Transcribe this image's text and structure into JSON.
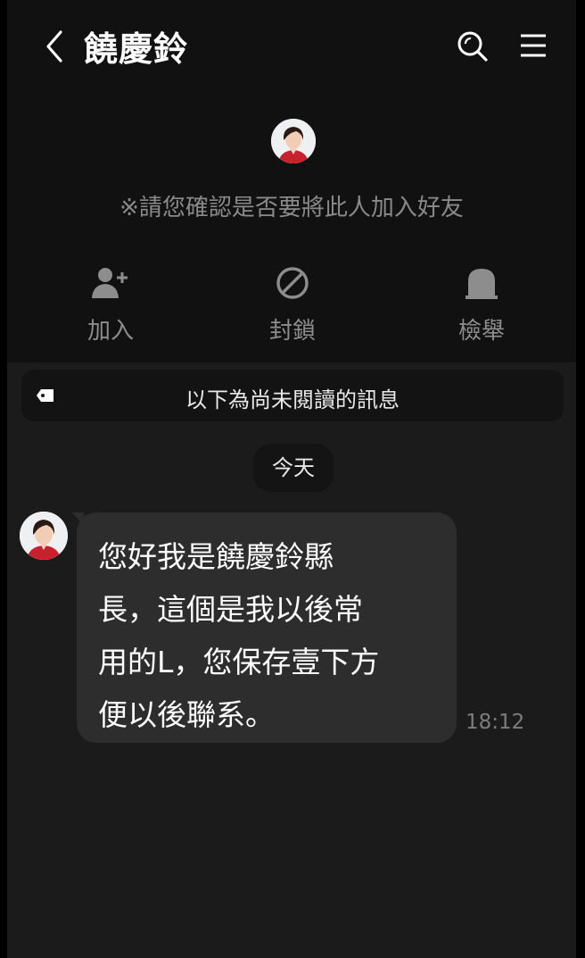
{
  "header": {
    "title": "饒慶鈴"
  },
  "profile": {
    "confirm_text": "※請您確認是否要將此人加入好友"
  },
  "actions": [
    {
      "label": "加入",
      "icon": "add-friend-icon"
    },
    {
      "label": "封鎖",
      "icon": "block-icon"
    },
    {
      "label": "檢舉",
      "icon": "report-icon"
    }
  ],
  "chat": {
    "unread_label": "以下為尚未閱讀的訊息",
    "date_label": "今天",
    "messages": [
      {
        "text": "您好我是饒慶鈴縣\n長，這個是我以後常\n用的L，您保存壹下方\n便以後聯系。",
        "time": "18:12"
      }
    ]
  },
  "colors": {
    "background": "#1b1b1b",
    "header_background": "#111111",
    "bubble": "#2d2d2d",
    "avatar_dress": "#c8202c"
  }
}
